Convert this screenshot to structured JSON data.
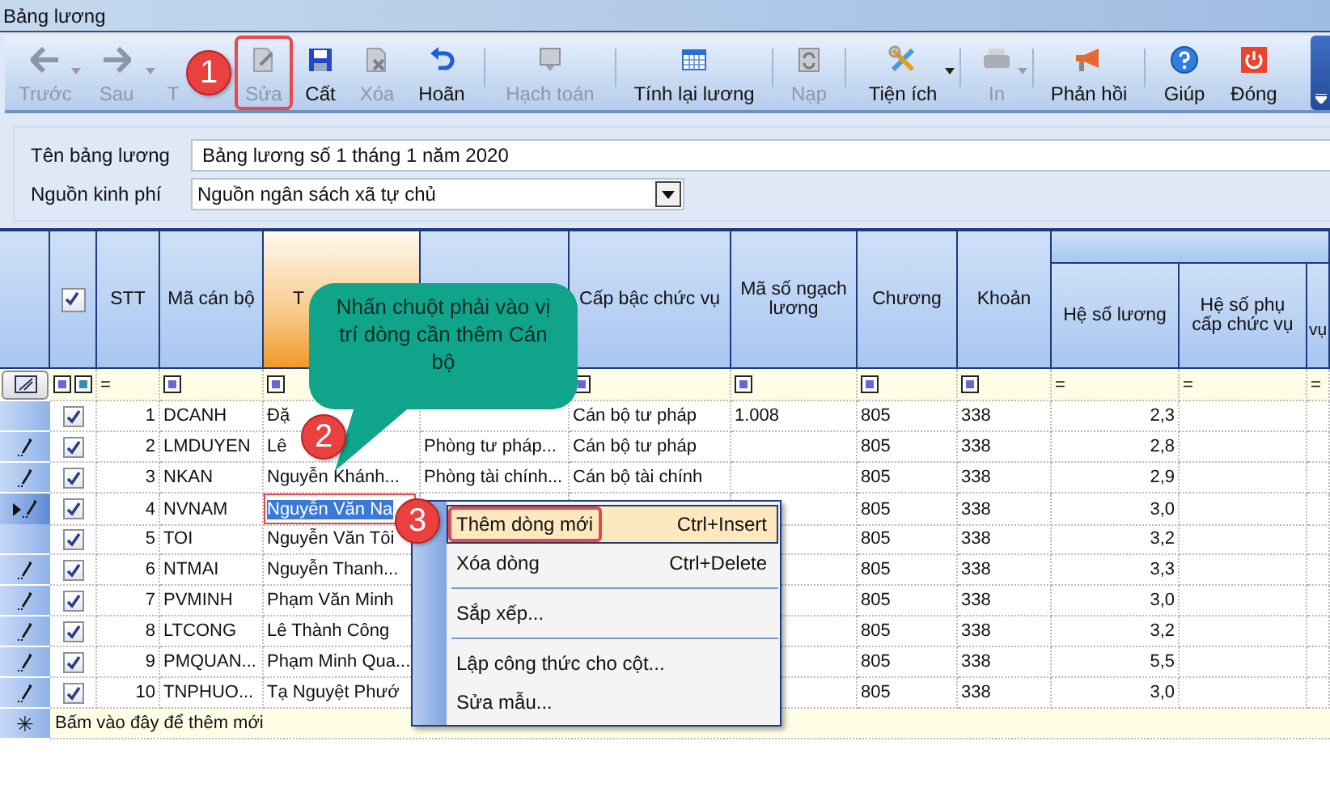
{
  "window": {
    "title": "Bảng lương"
  },
  "toolbar": [
    {
      "kind": "button",
      "label": "Trước",
      "disabled": true,
      "dropdown": true,
      "highlighted": false
    },
    {
      "kind": "button",
      "label": "Sau",
      "disabled": true,
      "dropdown": true,
      "highlighted": false
    },
    {
      "kind": "button",
      "label": "T",
      "disabled": true,
      "dropdown": false,
      "highlighted": false
    },
    {
      "kind": "button",
      "label": "Sửa",
      "disabled": true,
      "dropdown": false,
      "highlighted": true
    },
    {
      "kind": "button",
      "label": "Cất",
      "disabled": false,
      "dropdown": false,
      "highlighted": false
    },
    {
      "kind": "button",
      "label": "Xóa",
      "disabled": true,
      "dropdown": false,
      "highlighted": false
    },
    {
      "kind": "button",
      "label": "Hoãn",
      "disabled": false,
      "dropdown": false,
      "highlighted": false
    },
    {
      "kind": "separator"
    },
    {
      "kind": "button",
      "label": "Hạch toán",
      "disabled": true,
      "dropdown": false,
      "highlighted": false
    },
    {
      "kind": "separator"
    },
    {
      "kind": "button",
      "label": "Tính lại lương",
      "disabled": false,
      "dropdown": false,
      "highlighted": false
    },
    {
      "kind": "separator"
    },
    {
      "kind": "button",
      "label": "Nạp",
      "disabled": true,
      "dropdown": false,
      "highlighted": false
    },
    {
      "kind": "separator"
    },
    {
      "kind": "button",
      "label": "Tiện ích",
      "disabled": false,
      "dropdown": true,
      "highlighted": false
    },
    {
      "kind": "separator"
    },
    {
      "kind": "button",
      "label": "In",
      "disabled": true,
      "dropdown": true,
      "highlighted": false
    },
    {
      "kind": "separator"
    },
    {
      "kind": "button",
      "label": "Phản hồi",
      "disabled": false,
      "dropdown": false,
      "highlighted": false
    },
    {
      "kind": "separator"
    },
    {
      "kind": "button",
      "label": "Giúp",
      "disabled": false,
      "dropdown": false,
      "highlighted": false
    },
    {
      "kind": "button",
      "label": "Đóng",
      "disabled": false,
      "dropdown": false,
      "highlighted": false
    }
  ],
  "form": {
    "fields": [
      {
        "kind": "text",
        "label": "Tên bảng lương",
        "value": "Bảng lương số 1 tháng 1 năm 2020"
      },
      {
        "kind": "select",
        "label": "Nguồn kinh phí",
        "value": "Nguồn ngân sách xã tự chủ"
      }
    ]
  },
  "grid": {
    "columns": [
      {
        "kind": "checkbox",
        "checked": true,
        "group": false,
        "active": false,
        "filter": {
          "kind": "double"
        }
      },
      {
        "kind": "text",
        "header": "STT",
        "group": false,
        "active": false,
        "filter": {
          "kind": "text",
          "text": "="
        }
      },
      {
        "kind": "text",
        "header": "Mã cán bộ",
        "group": false,
        "active": false,
        "filter": {
          "kind": "square"
        }
      },
      {
        "kind": "text",
        "header": "T",
        "group": false,
        "active": true,
        "filter": {
          "kind": "square"
        }
      },
      {
        "kind": "text",
        "group": false,
        "active": false
      },
      {
        "kind": "text",
        "header": "Cấp bậc chức vụ",
        "group": false,
        "active": false,
        "filter": {
          "kind": "square"
        }
      },
      {
        "kind": "text",
        "header": "Mã số ngạch lương",
        "group": false,
        "active": false,
        "filter": {
          "kind": "square"
        }
      },
      {
        "kind": "text",
        "header": "Chương",
        "group": false,
        "active": false,
        "filter": {
          "kind": "square"
        }
      },
      {
        "kind": "text",
        "header": "Khoản",
        "group": false,
        "active": false,
        "filter": {
          "kind": "square"
        }
      },
      {
        "kind": "text",
        "header": "Hệ số lương",
        "group": true,
        "active": false,
        "filter": {
          "kind": "text",
          "text": "="
        }
      },
      {
        "kind": "text",
        "header": "Hệ số phụ cấp chức vụ",
        "group": true,
        "active": false,
        "filter": {
          "kind": "text",
          "text": "="
        }
      },
      {
        "kind": "text",
        "header": "vụ",
        "group": true,
        "active": false,
        "filter": {
          "kind": "text",
          "text": "="
        }
      }
    ],
    "rows": [
      {
        "editing": false,
        "selected": false,
        "checked": true,
        "cells": [
          null,
          "1",
          "DCANH",
          "Đặ",
          null,
          "Cán bộ tư pháp",
          "1.008",
          "805",
          "338",
          "2,3",
          null,
          null
        ]
      },
      {
        "editing": true,
        "selected": false,
        "checked": true,
        "cells": [
          null,
          "2",
          "LMDUYEN",
          "Lê",
          "Phòng tư pháp...",
          "Cán bộ tư pháp",
          null,
          "805",
          "338",
          "2,8",
          null,
          null
        ]
      },
      {
        "editing": true,
        "selected": false,
        "checked": true,
        "cells": [
          null,
          "3",
          "NKAN",
          "Nguyễn Khánh...",
          "Phòng tài chính...",
          "Cán bộ tài chính",
          null,
          "805",
          "338",
          "2,9",
          null,
          null
        ]
      },
      {
        "editing": true,
        "selected": true,
        "checked": true,
        "cells": [
          null,
          "4",
          "NVNAM",
          "Nguyễn Văn Na",
          null,
          null,
          null,
          "805",
          "338",
          "3,0",
          null,
          null
        ]
      },
      {
        "editing": false,
        "selected": false,
        "checked": true,
        "cells": [
          null,
          "5",
          "TOI",
          "Nguyễn Văn Tôi",
          null,
          null,
          null,
          "805",
          "338",
          "3,2",
          null,
          null
        ]
      },
      {
        "editing": true,
        "selected": false,
        "checked": true,
        "cells": [
          null,
          "6",
          "NTMAI",
          "Nguyễn Thanh...",
          null,
          null,
          null,
          "805",
          "338",
          "3,3",
          null,
          null
        ]
      },
      {
        "editing": true,
        "selected": false,
        "checked": true,
        "cells": [
          null,
          "7",
          "PVMINH",
          "Phạm Văn Minh",
          null,
          null,
          null,
          "805",
          "338",
          "3,0",
          null,
          null
        ]
      },
      {
        "editing": true,
        "selected": false,
        "checked": true,
        "cells": [
          null,
          "8",
          "LTCONG",
          "Lê Thành Công",
          null,
          null,
          null,
          "805",
          "338",
          "3,2",
          null,
          null
        ]
      },
      {
        "editing": true,
        "selected": false,
        "checked": true,
        "cells": [
          null,
          "9",
          "PMQUAN...",
          "Phạm Minh Qua...",
          null,
          null,
          null,
          "805",
          "338",
          "5,5",
          null,
          null
        ]
      },
      {
        "editing": true,
        "selected": false,
        "checked": true,
        "cells": [
          null,
          "10",
          "TNPHUO...",
          "Tạ Nguyệt Phướ",
          null,
          null,
          null,
          "805",
          "338",
          "3,0",
          null,
          null
        ]
      }
    ],
    "new_row": {
      "marker": "✳",
      "text": "Bấm vào đây để thêm mới"
    }
  },
  "context_menu": {
    "items": [
      {
        "kind": "item",
        "label": "Thêm dòng mới",
        "shortcut": "Ctrl+Insert",
        "highlighted": true
      },
      {
        "kind": "item",
        "label": "Xóa dòng",
        "shortcut": "Ctrl+Delete",
        "highlighted": false
      },
      {
        "kind": "separator"
      },
      {
        "kind": "item",
        "label": "Sắp xếp...",
        "highlighted": false
      },
      {
        "kind": "separator"
      },
      {
        "kind": "item",
        "label": "Lập công thức cho cột...",
        "highlighted": false
      },
      {
        "kind": "item",
        "label": "Sửa mẫu...",
        "highlighted": false
      }
    ]
  },
  "annotations": {
    "badges": [
      "1",
      "2",
      "3"
    ],
    "callout": "Nhấn chuột phải vào vị trí dòng cần thêm Cán bộ"
  }
}
